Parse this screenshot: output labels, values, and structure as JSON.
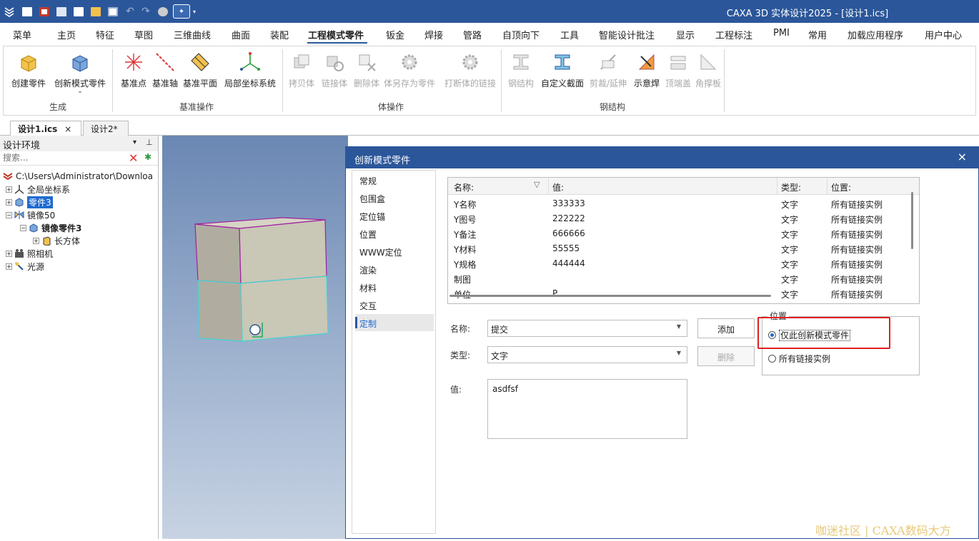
{
  "titlebar": {
    "title": "CAXA 3D 实体设计2025 - [设计1.ics]"
  },
  "menu": [
    "菜单",
    "主页",
    "特征",
    "草图",
    "三维曲线",
    "曲面",
    "装配",
    "工程模式零件",
    "钣金",
    "焊接",
    "管路",
    "自顶向下",
    "工具",
    "智能设计批注",
    "显示",
    "工程标注",
    "PMI",
    "常用",
    "加载应用程序",
    "用户中心"
  ],
  "ribbon": {
    "buttons": [
      "创建零件",
      "创新模式零件",
      "基准点",
      "基准轴",
      "基准平面",
      "局部坐标系统",
      "拷贝体",
      "链接体",
      "删除体",
      "体另存为零件",
      "打断体的链接",
      "钢结构",
      "自定义截面",
      "剪裁/延伸",
      "示意焊",
      "顶端盖",
      "角撑板"
    ],
    "groups": [
      "生成",
      "基准操作",
      "体操作",
      "钢结构"
    ]
  },
  "doc_tabs": [
    "设计1.ics",
    "设计2*"
  ],
  "left_panel": {
    "title": "设计环境",
    "search_placeholder": "搜索...",
    "tree": [
      "C:\\Users\\Administrator\\Downloa",
      "全局坐标系",
      "零件3",
      "镜像50",
      "镜像零件3",
      "长方体",
      "照相机",
      "光源"
    ]
  },
  "dialog": {
    "title": "创新模式零件",
    "nav": [
      "常规",
      "包围盒",
      "定位锚",
      "位置",
      "WWW定位",
      "渲染",
      "材料",
      "交互",
      "定制"
    ],
    "table": {
      "headers": [
        "名称:",
        "值:",
        "类型:",
        "位置:"
      ],
      "rows": [
        [
          "Y名称",
          "333333",
          "文字",
          "所有链接实例"
        ],
        [
          "Y图号",
          "222222",
          "文字",
          "所有链接实例"
        ],
        [
          "Y备注",
          "666666",
          "文字",
          "所有链接实例"
        ],
        [
          "Y材料",
          "55555",
          "文字",
          "所有链接实例"
        ],
        [
          "Y规格",
          "444444",
          "文字",
          "所有链接实例"
        ],
        [
          "制图",
          "",
          "文字",
          "所有链接实例"
        ],
        [
          "单位",
          "P",
          "文字",
          "所有链接实例"
        ]
      ]
    },
    "form": {
      "name_label": "名称:",
      "name_value": "提交",
      "type_label": "类型:",
      "type_value": "文字",
      "value_label": "值:",
      "value_text": "asdfsf",
      "add_button": "添加",
      "delete_button": "删除"
    },
    "position": {
      "legend": "位置",
      "options": [
        "仅此创新模式零件",
        "所有链接实例"
      ],
      "selected": 0
    }
  },
  "watermark": "咖迷社区 | CAXA数码大方"
}
